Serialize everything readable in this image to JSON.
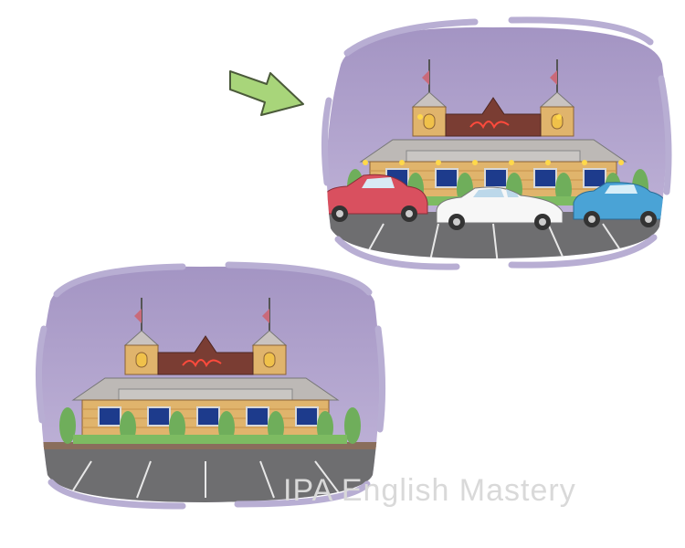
{
  "watermark": {
    "text": "IPA English Mastery"
  },
  "scenes": [
    {
      "id": "after",
      "description_icon": "restaurant-with-parked-cars",
      "cars": 3
    },
    {
      "id": "before",
      "description_icon": "restaurant-empty-lot",
      "cars": 0
    }
  ],
  "arrow": {
    "icon": "right-arrow-icon",
    "color": "#a8d57a"
  },
  "colors": {
    "sky": "#a99ac7",
    "sky_light": "#c0b3d9",
    "frame": "#b8aed3",
    "wood": "#e0b46c",
    "wood_dark": "#c8924a",
    "roof": "#b9b6b3",
    "sign": "#7a3d33",
    "sign_text": "#ff4040",
    "window": "#1d3b8c",
    "bush": "#6fae5b",
    "lot": "#6e6e70",
    "car_red": "#d9505f",
    "car_white": "#f5f5f5",
    "car_blue": "#4aa3d6"
  }
}
